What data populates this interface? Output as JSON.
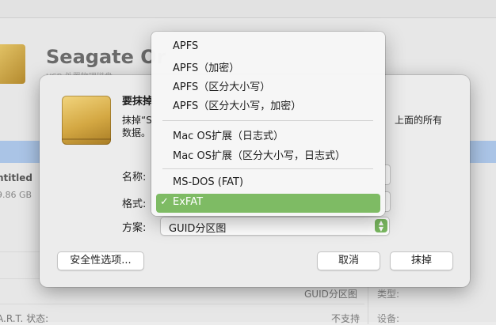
{
  "background": {
    "drive_name": "Seagate Or",
    "drive_sub": "USB 外置物理磁盘",
    "volume_name": "ntitled",
    "volume_size": "9.86 GB",
    "scheme_value": "GUID分区图",
    "type_label": "类型:",
    "smart_label": "A.R.T. 状态:",
    "smart_value": "不支持",
    "device_label": "设备:"
  },
  "sheet": {
    "title": "要抹掉",
    "description_line1": "抹掉“S",
    "description_tail": "上面的所有",
    "description_line2": "数据。",
    "name_label": "名称:",
    "format_label": "格式:",
    "scheme_label": "方案:",
    "scheme_value": "GUID分区图",
    "security_button": "安全性选项...",
    "cancel_button": "取消",
    "erase_button": "抹掉"
  },
  "format_menu": {
    "items": [
      {
        "label": "APFS"
      },
      {
        "label": "APFS（加密）"
      },
      {
        "label": "APFS（区分大小写）"
      },
      {
        "label": "APFS（区分大小写，加密）"
      },
      {
        "label": "Mac OS扩展（日志式）"
      },
      {
        "label": "Mac OS扩展（区分大小写，日志式）"
      },
      {
        "label": "MS-DOS (FAT)"
      },
      {
        "label": "ExFAT"
      }
    ],
    "selected": "ExFAT",
    "checkmark": "✓"
  },
  "colors": {
    "accent": "#7ebb64",
    "selection_bg_row": "#aac4e6"
  }
}
